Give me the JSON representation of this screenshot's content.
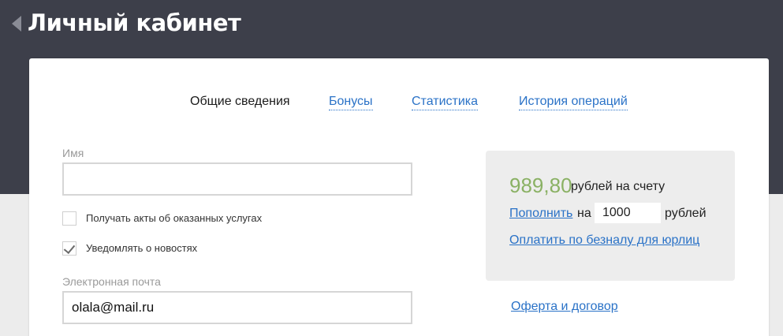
{
  "header": {
    "title": "Личный кабинет",
    "back_icon": "back-arrow-icon"
  },
  "tabs": [
    {
      "label": "Общие сведения",
      "active": true
    },
    {
      "label": "Бонусы",
      "active": false
    },
    {
      "label": "Статистика",
      "active": false
    },
    {
      "label": "История операций",
      "active": false
    }
  ],
  "form": {
    "name": {
      "label": "Имя",
      "value": ""
    },
    "acts_checkbox": {
      "label": "Получать акты об оказанных услугах",
      "checked": false
    },
    "news_checkbox": {
      "label": "Уведомлять о новостях",
      "checked": true
    },
    "email": {
      "label": "Электронная почта",
      "value": "olala@mail.ru"
    }
  },
  "balance": {
    "amount": "989,80",
    "amount_text": "рублей на счету",
    "topup_link": "Пополнить",
    "topup_on": "на",
    "topup_value": "1000",
    "topup_currency": "рублей",
    "cashless_link": "Оплатить по безналу для юрлиц"
  },
  "offer_link": "Оферта и договор",
  "colors": {
    "header_bg": "#3d3f4a",
    "link": "#2a72c7",
    "balance_amount": "#8ab164",
    "balance_box_bg": "#ededed"
  }
}
